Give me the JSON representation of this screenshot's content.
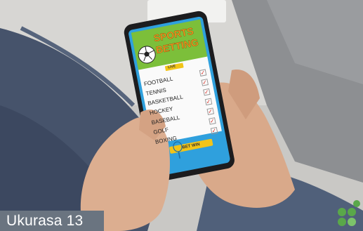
{
  "caption": {
    "text": "Ukurasa 13"
  },
  "app": {
    "title_line1": "SPORTS",
    "title_line2": "BETTING",
    "live_label": "LIVE",
    "sports": [
      "FOOTBALL",
      "TENNIS",
      "BASKETBALL",
      "HOCKEY",
      "BASEBALL",
      "GOLF",
      "BOXING"
    ],
    "bet_button_label": "BET WIN"
  },
  "colors": {
    "header_green": "#7cbf3a",
    "screen_blue": "#2fa0dd",
    "title_orange": "#f0941e",
    "check_red": "#d8332a",
    "button_yellow": "#f2c418",
    "logo_green": "#5aa84a"
  },
  "icons": {
    "logo": "leaf-logo-icon",
    "ball": "soccer-ball-icon",
    "check": "checkmark-icon",
    "racket": "tennis-racket-icon"
  }
}
